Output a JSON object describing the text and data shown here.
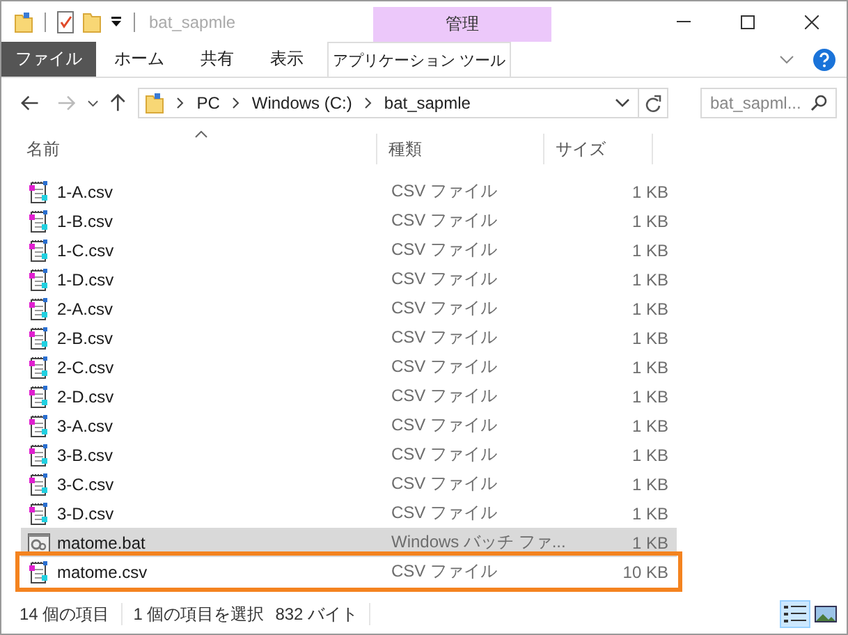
{
  "window": {
    "title": "bat_sapmle"
  },
  "ribbon": {
    "context_group": "管理",
    "tabs": [
      {
        "label": "ファイル",
        "kind": "file"
      },
      {
        "label": "ホーム",
        "kind": "normal"
      },
      {
        "label": "共有",
        "kind": "normal"
      },
      {
        "label": "表示",
        "kind": "normal"
      },
      {
        "label": "アプリケーション ツール",
        "kind": "context"
      }
    ]
  },
  "address": {
    "path": [
      "PC",
      "Windows (C:)",
      "bat_sapmle"
    ]
  },
  "search": {
    "placeholder": "bat_sapml..."
  },
  "columns": [
    "名前",
    "種類",
    "サイズ"
  ],
  "rows": [
    {
      "name": "1-A.csv",
      "type": "CSV ファイル",
      "size": "1 KB",
      "kind": "csv",
      "selected": false,
      "highlighted": false
    },
    {
      "name": "1-B.csv",
      "type": "CSV ファイル",
      "size": "1 KB",
      "kind": "csv",
      "selected": false,
      "highlighted": false
    },
    {
      "name": "1-C.csv",
      "type": "CSV ファイル",
      "size": "1 KB",
      "kind": "csv",
      "selected": false,
      "highlighted": false
    },
    {
      "name": "1-D.csv",
      "type": "CSV ファイル",
      "size": "1 KB",
      "kind": "csv",
      "selected": false,
      "highlighted": false
    },
    {
      "name": "2-A.csv",
      "type": "CSV ファイル",
      "size": "1 KB",
      "kind": "csv",
      "selected": false,
      "highlighted": false
    },
    {
      "name": "2-B.csv",
      "type": "CSV ファイル",
      "size": "1 KB",
      "kind": "csv",
      "selected": false,
      "highlighted": false
    },
    {
      "name": "2-C.csv",
      "type": "CSV ファイル",
      "size": "1 KB",
      "kind": "csv",
      "selected": false,
      "highlighted": false
    },
    {
      "name": "2-D.csv",
      "type": "CSV ファイル",
      "size": "1 KB",
      "kind": "csv",
      "selected": false,
      "highlighted": false
    },
    {
      "name": "3-A.csv",
      "type": "CSV ファイル",
      "size": "1 KB",
      "kind": "csv",
      "selected": false,
      "highlighted": false
    },
    {
      "name": "3-B.csv",
      "type": "CSV ファイル",
      "size": "1 KB",
      "kind": "csv",
      "selected": false,
      "highlighted": false
    },
    {
      "name": "3-C.csv",
      "type": "CSV ファイル",
      "size": "1 KB",
      "kind": "csv",
      "selected": false,
      "highlighted": false
    },
    {
      "name": "3-D.csv",
      "type": "CSV ファイル",
      "size": "1 KB",
      "kind": "csv",
      "selected": false,
      "highlighted": false
    },
    {
      "name": "matome.bat",
      "type": "Windows バッチ ファ...",
      "size": "1 KB",
      "kind": "bat",
      "selected": true,
      "highlighted": false
    },
    {
      "name": "matome.csv",
      "type": "CSV ファイル",
      "size": "10 KB",
      "kind": "csv",
      "selected": false,
      "highlighted": true
    }
  ],
  "status_bar": {
    "item_count": "14 個の項目",
    "selection": "1 個の項目を選択",
    "selection_size": "832 バイト"
  },
  "views": [
    {
      "kind": "details",
      "selected": true
    },
    {
      "kind": "large_icons",
      "selected": false
    }
  ]
}
